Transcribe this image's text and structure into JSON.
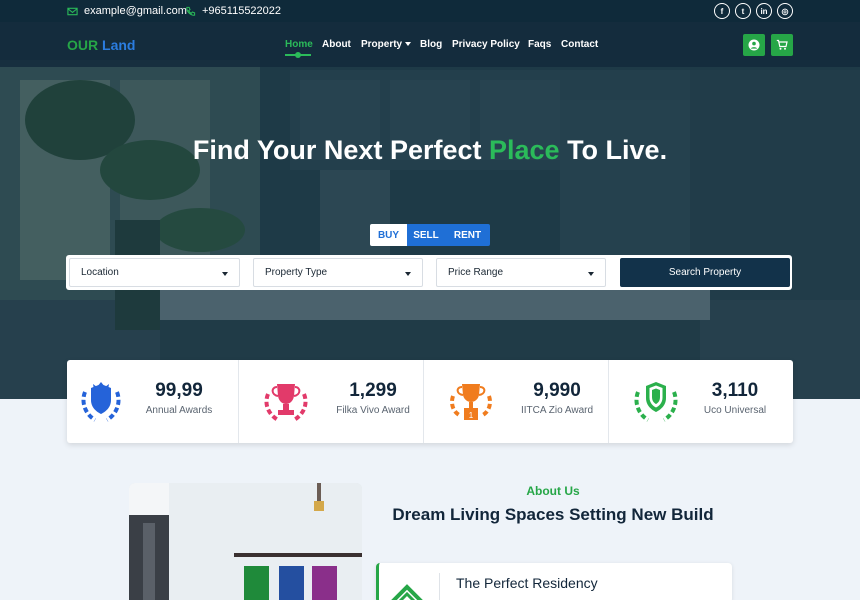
{
  "topbar": {
    "email": "example@gmail.com",
    "phone": "+965115522022",
    "social": [
      {
        "icon": "facebook-icon",
        "glyph": "f"
      },
      {
        "icon": "twitter-icon",
        "glyph": "t"
      },
      {
        "icon": "linkedin-icon",
        "glyph": "in"
      },
      {
        "icon": "instagram-icon",
        "glyph": "◎"
      }
    ]
  },
  "navbar": {
    "brand_part1": "OUR",
    "brand_part2": "Land",
    "items": [
      {
        "label": "Home",
        "active": true
      },
      {
        "label": "About"
      },
      {
        "label": "Property",
        "dropdown": true
      },
      {
        "label": "Blog"
      },
      {
        "label": "Privacy Policy"
      },
      {
        "label": "Faqs"
      },
      {
        "label": "Contact"
      }
    ],
    "icons": [
      "user-icon",
      "cart-icon"
    ]
  },
  "hero": {
    "title_before": "Find Your Next Perfect ",
    "title_highlight": "Place",
    "title_after": " To Live.",
    "tabs": [
      "BUY",
      "SELL",
      "RENT"
    ],
    "active_tab": "BUY",
    "filters": [
      {
        "label": "Location"
      },
      {
        "label": "Property Type"
      },
      {
        "label": "Price Range"
      }
    ],
    "search_label": "Search Property"
  },
  "stats": [
    {
      "value": "99,99",
      "label": "Annual Awards",
      "icon": "shield-laurel-icon",
      "color": "#2563d9"
    },
    {
      "value": "1,299",
      "label": "Filka Vivo Award",
      "icon": "trophy-laurel-icon",
      "color": "#e23a6a"
    },
    {
      "value": "9,990",
      "label": "IITCA Zio Award",
      "icon": "trophy-first-icon",
      "color": "#f07c1e"
    },
    {
      "value": "3,110",
      "label": "Uco Universal",
      "icon": "shield-laurel-icon",
      "color": "#2bb04c"
    }
  ],
  "about": {
    "eyebrow": "About Us",
    "title": "Dream Living Spaces Setting New Build",
    "feature_title": "The Perfect Residency"
  },
  "colors": {
    "accent_green": "#26a647",
    "accent_blue": "#1f6fd6",
    "navy": "#12324a"
  }
}
